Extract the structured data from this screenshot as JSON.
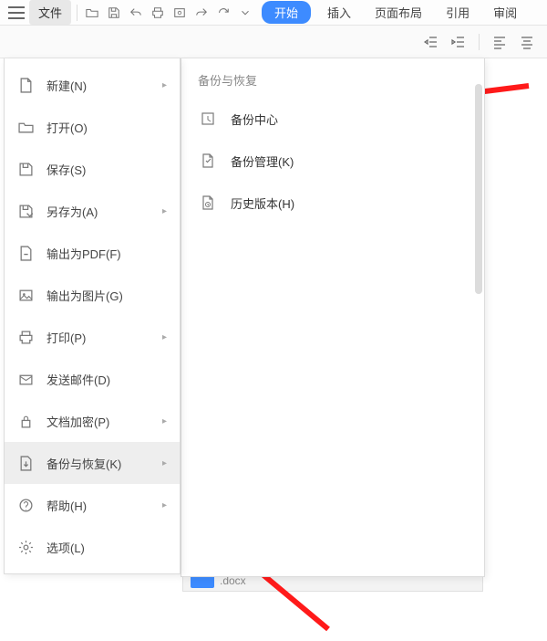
{
  "topbar": {
    "file_label": "文件"
  },
  "ribbon": {
    "start": "开始",
    "insert": "插入",
    "layout": "页面布局",
    "references": "引用",
    "review": "审阅"
  },
  "file_menu": {
    "items": [
      {
        "label": "新建(N)",
        "has_sub": true
      },
      {
        "label": "打开(O)",
        "has_sub": false
      },
      {
        "label": "保存(S)",
        "has_sub": false
      },
      {
        "label": "另存为(A)",
        "has_sub": true
      },
      {
        "label": "输出为PDF(F)",
        "has_sub": false
      },
      {
        "label": "输出为图片(G)",
        "has_sub": false
      },
      {
        "label": "打印(P)",
        "has_sub": true
      },
      {
        "label": "发送邮件(D)",
        "has_sub": false
      },
      {
        "label": "文档加密(P)",
        "has_sub": true
      },
      {
        "label": "备份与恢复(K)",
        "has_sub": true,
        "hovered": true
      },
      {
        "label": "帮助(H)",
        "has_sub": true
      },
      {
        "label": "选项(L)",
        "has_sub": false
      }
    ]
  },
  "submenu": {
    "title": "备份与恢复",
    "items": [
      {
        "label": "备份中心"
      },
      {
        "label": "备份管理(K)"
      },
      {
        "label": "历史版本(H)"
      }
    ]
  },
  "doc_hint": {
    "text": ".docx"
  }
}
